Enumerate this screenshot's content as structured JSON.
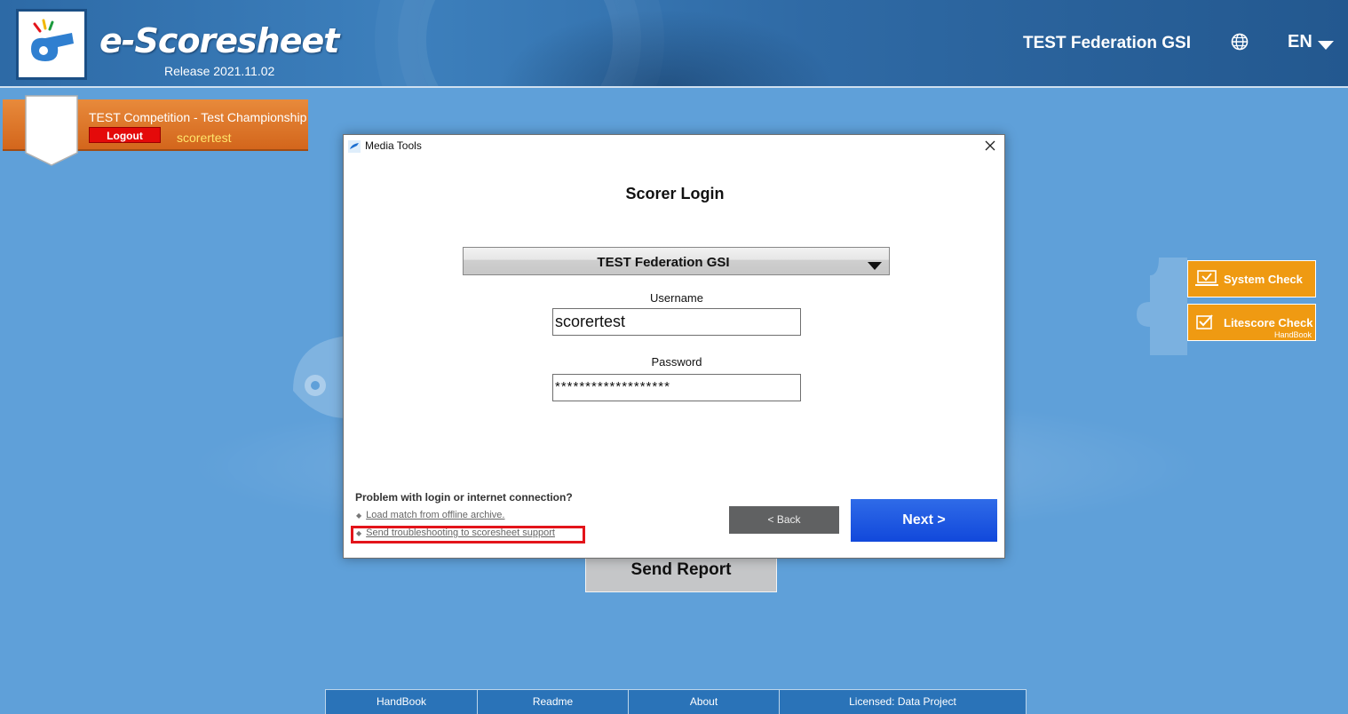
{
  "header": {
    "app_title": "e-Scoresheet",
    "release": "Release 2021.11.02",
    "federation": "TEST Federation GSI",
    "language": "EN"
  },
  "session": {
    "competition": "TEST Competition - Test Championship",
    "logout_label": "Logout",
    "username": "scorertest"
  },
  "side_buttons": {
    "system_check": "System Check",
    "litescore_check": "Litescore Check",
    "litescore_sub": "HandBook"
  },
  "send_report": "Send Report",
  "footer": {
    "items": [
      "HandBook",
      "Readme",
      "About",
      "Licensed: Data Project"
    ]
  },
  "dialog": {
    "window_title": "Media Tools",
    "heading": "Scorer Login",
    "federation_selected": "TEST Federation GSI",
    "username_label": "Username",
    "username_value": "scorertest",
    "password_label": "Password",
    "password_value": "*******************",
    "help_heading": "Problem with login or internet connection?",
    "help_links": [
      "Load match from offline archive.",
      "Send troubleshooting to scoresheet support"
    ],
    "back_label": "< Back",
    "next_label": "Next >"
  },
  "colors": {
    "background": "#5fa0d9",
    "header": "#2d6aa6",
    "ribbon": "#d3661c",
    "side_button": "#ef9a12",
    "next_button": "#1148db",
    "highlight_box": "#e3141a"
  }
}
